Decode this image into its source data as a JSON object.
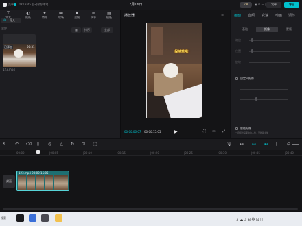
{
  "titlebar": {
    "menu_label": "菜单",
    "autosave": "09:13:45 自动保存本地",
    "title": "2月16日",
    "vip": "VIP",
    "publish": "发布",
    "export": "导出",
    "icons": "▣ ⊡ — ▢ ✕"
  },
  "toolbar": [
    {
      "icon": "T",
      "label": "文本"
    },
    {
      "icon": "◐",
      "label": "贴纸"
    },
    {
      "icon": "✦",
      "label": "特效"
    },
    {
      "icon": "⋈",
      "label": "转场"
    },
    {
      "icon": "♦",
      "label": "滤镜"
    },
    {
      "icon": "≋",
      "label": "调节"
    },
    {
      "icon": "▤",
      "label": "模板"
    }
  ],
  "media": {
    "import_label": "导入",
    "all_label": "全部",
    "sort_label": "排序",
    "all_button": "全部",
    "item": {
      "added": "已添加",
      "duration": "00:31",
      "name": "123.mp4"
    }
  },
  "player": {
    "title": "播放器",
    "overlay_text": "保持乖哦！",
    "time_current": "00:00:06:07",
    "time_total": "00:00:15:05"
  },
  "right_panel": {
    "tabs": [
      "画面",
      "音频",
      "变速",
      "动画",
      "调节"
    ],
    "segments": [
      "基础",
      "抠像",
      "蒙版"
    ],
    "props": [
      "缩放",
      "位置",
      "旋转"
    ],
    "custom_cutout": "自定义抠像",
    "smart_cutout": "智能抠像",
    "smart_desc": "一键抠出画面中的人像、宠物等主体"
  },
  "timeline": {
    "ticks": [
      "00:00",
      "|00:05",
      "|00:10",
      "|00:15",
      "|00:20",
      "|00:25",
      "|00:30",
      "|00:35",
      "|00:40"
    ],
    "cover_label": "封面",
    "clip_label": "123.mp4  00:00:15:05"
  },
  "taskbar": {
    "search": "搜索",
    "tray": "∧  ☁  ♪  ⊞  英  ⊡  ◫"
  }
}
